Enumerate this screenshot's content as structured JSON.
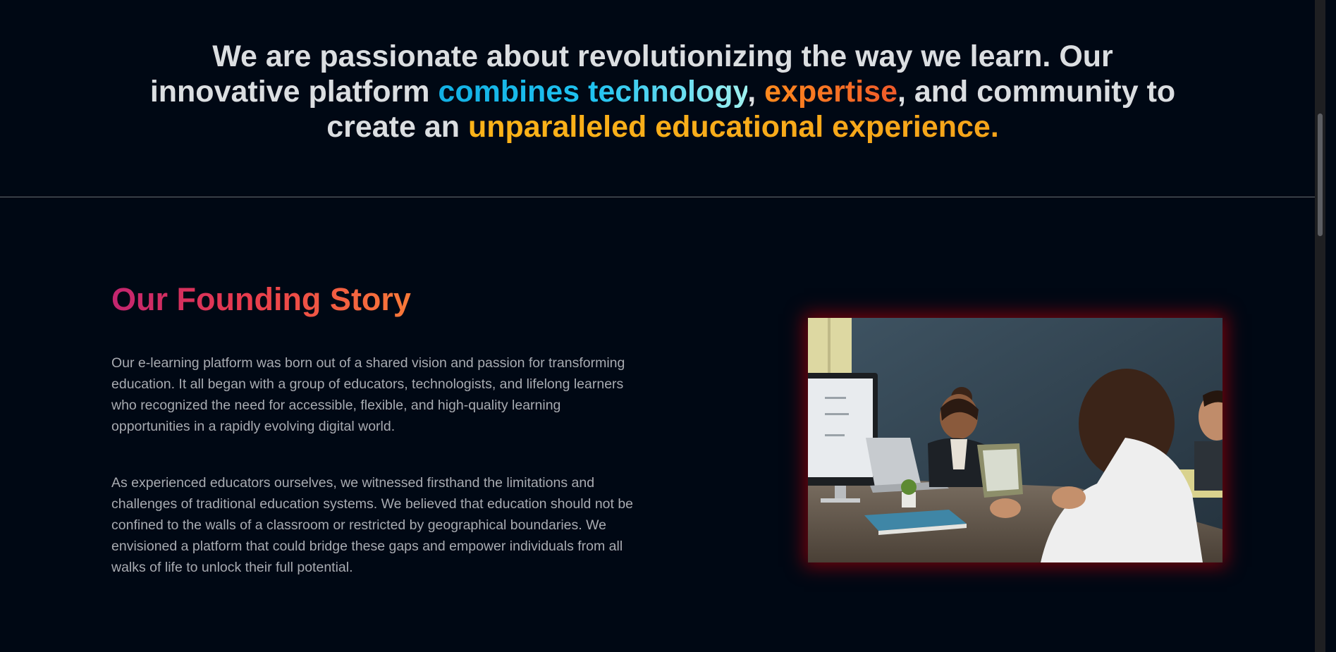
{
  "hero": {
    "line1": "We are passionate about revolutionizing the way we learn. Our",
    "line2_start": "innovative platform ",
    "highlight_tech": "combines technology",
    "comma": ",",
    "highlight_expertise": "expertise",
    "line2_end": ", and community to",
    "line3_start": "create an ",
    "highlight_experience": "unparalleled educational experience."
  },
  "story": {
    "title": "Our Founding Story",
    "paragraph1": "Our e-learning platform was born out of a shared vision and passion for transforming education. It all began with a group of educators, technologists, and lifelong learners who recognized the need for accessible, flexible, and high-quality learning opportunities in a rapidly evolving digital world.",
    "paragraph2": "As experienced educators ourselves, we witnessed firsthand the limitations and challenges of traditional education systems. We believed that education should not be confined to the walls of a classroom or restricted by geographical boundaries. We envisioned a platform that could bridge these gaps and empower individuals from all walks of life to unlock their full potential."
  },
  "image": {
    "subject": "students-working-at-computers-in-classroom"
  },
  "colors": {
    "background": "#000814",
    "heading_text": "#dbdee1",
    "body_text": "#a8abb1",
    "accent_blue": "#12b0e4",
    "accent_orange": "#ff8a1d",
    "accent_yellow": "#fbb319",
    "glow_red": "#96000a"
  }
}
